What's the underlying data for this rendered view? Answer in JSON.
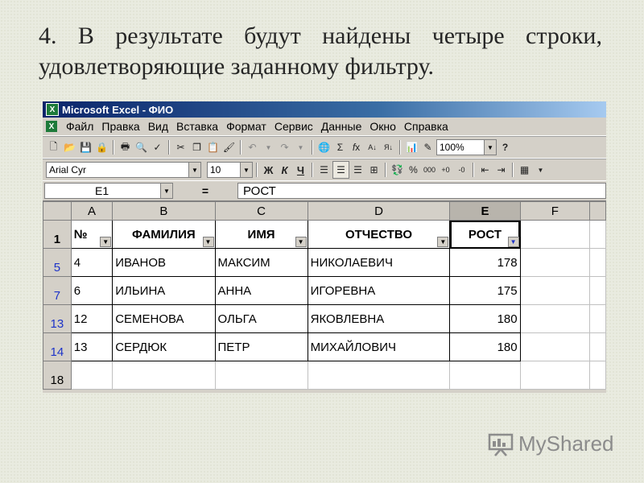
{
  "slide": {
    "line1_words": [
      "4.",
      "В",
      "результате",
      "будут",
      "найдены",
      "четыре",
      "строки,"
    ],
    "line2": "удовлетворяющие заданному фильтру."
  },
  "window": {
    "title": "Microsoft Excel - ФИО",
    "app_icon_text": "X"
  },
  "menu": [
    "Файл",
    "Правка",
    "Вид",
    "Вставка",
    "Формат",
    "Сервис",
    "Данные",
    "Окно",
    "Справка"
  ],
  "toolbar": {
    "zoom": "100%"
  },
  "format_bar": {
    "font": "Arial Cyr",
    "size": "10",
    "bold": "Ж",
    "italic": "К",
    "underline": "Ч"
  },
  "formula_bar": {
    "name_box": "E1",
    "equals": "=",
    "value": "РОСТ"
  },
  "sheet": {
    "columns": [
      "A",
      "B",
      "C",
      "D",
      "E",
      "F"
    ],
    "header_row": {
      "row_num": "1",
      "cells": [
        "№",
        "ФАМИЛИЯ",
        "ИМЯ",
        "ОТЧЕСТВО",
        "РОСТ"
      ]
    },
    "rows": [
      {
        "row_num": "5",
        "cells": [
          "4",
          "ИВАНОВ",
          "МАКСИМ",
          "НИКОЛАЕВИЧ",
          "178"
        ]
      },
      {
        "row_num": "7",
        "cells": [
          "6",
          "ИЛЬИНА",
          "АННА",
          "ИГОРЕВНА",
          "175"
        ]
      },
      {
        "row_num": "13",
        "cells": [
          "12",
          "СЕМЕНОВА",
          "ОЛЬГА",
          "ЯКОВЛЕВНА",
          "180"
        ]
      },
      {
        "row_num": "14",
        "cells": [
          "13",
          "СЕРДЮК",
          "ПЕТР",
          "МИХАЙЛОВИЧ",
          "180"
        ]
      }
    ],
    "empty_row": "18"
  },
  "watermark": {
    "text": "MyShared"
  }
}
